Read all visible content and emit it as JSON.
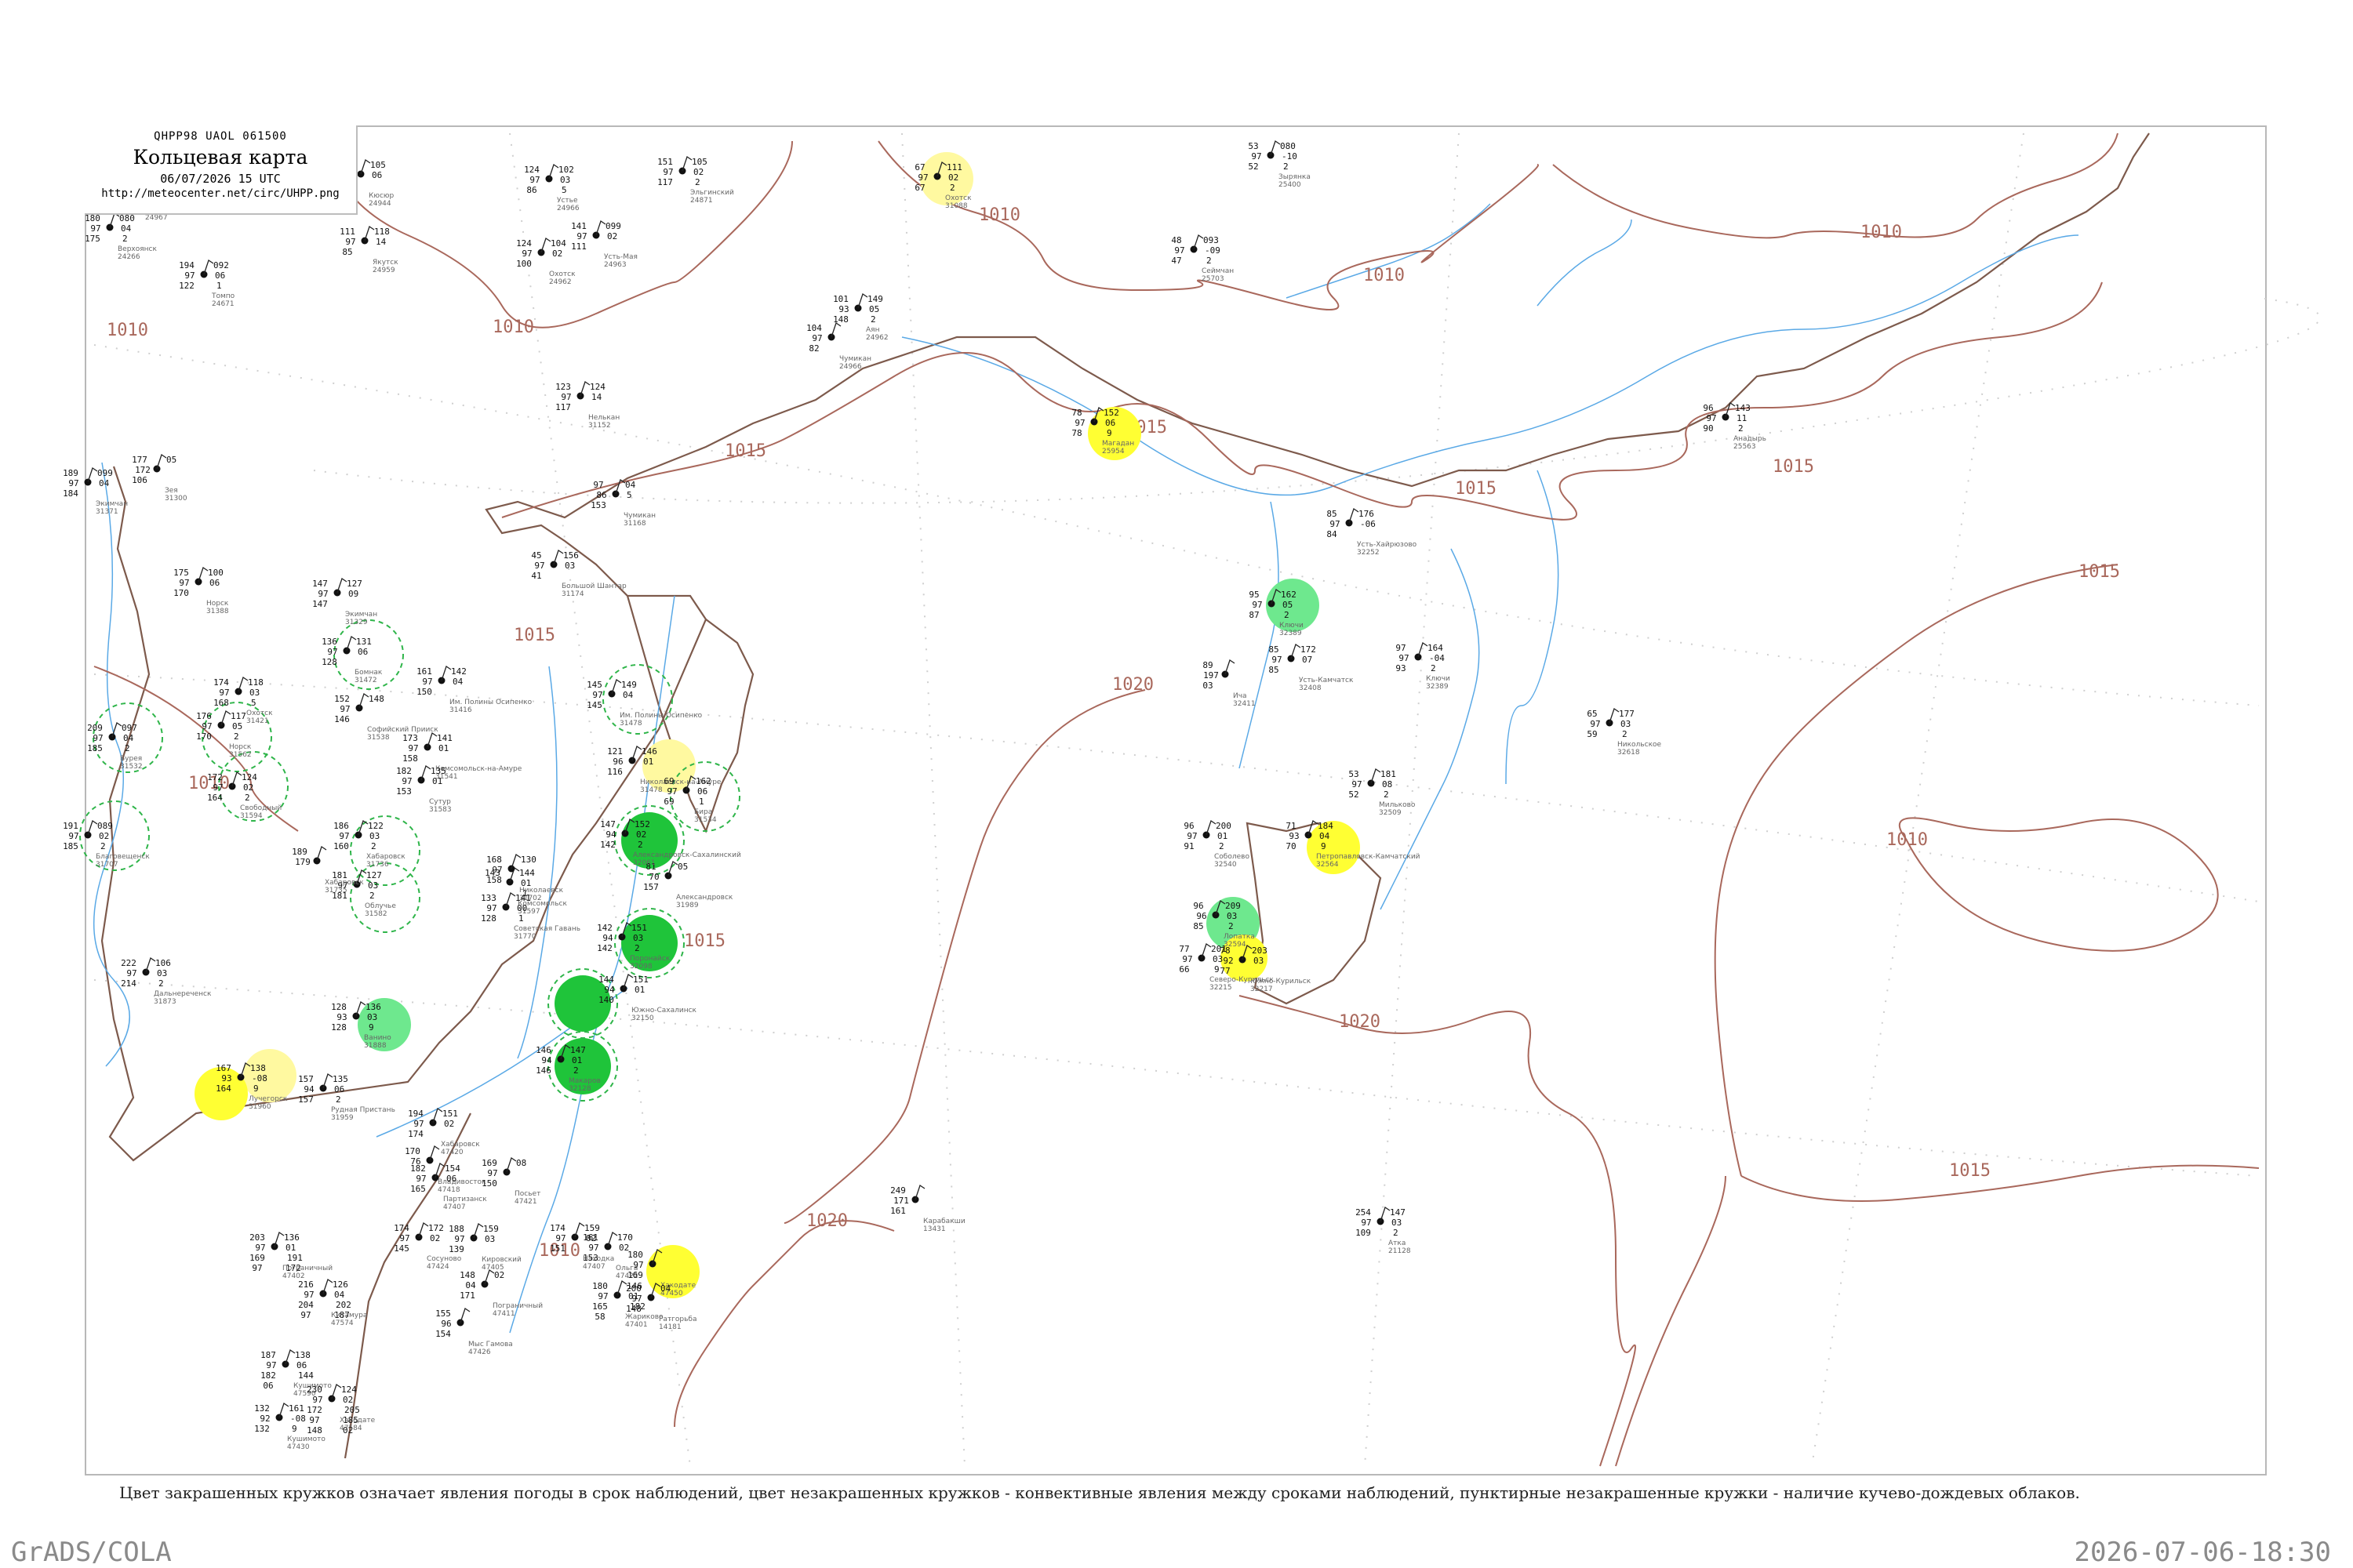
{
  "header": {
    "code_line": "QHPP98  UAOL  061500",
    "title": "Кольцевая карта",
    "datetime": "06/07/2026 15 UTC",
    "url": "http://meteocenter.net/circ/UHPP.png"
  },
  "caption": "Цвет закрашенных кружков означает явления погоды в срок наблюдений, цвет незакрашенных кружков - конвективные явления между сроками наблюдений, пунктирные незакрашенные кружки - наличие кучево-дождевых облаков.",
  "footer": {
    "left": "GrADS/COLA",
    "right": "2026-07-06-18:30"
  },
  "colors": {
    "isobar": "#a9685c",
    "water": "#5aa9e6",
    "coast": "#7d5a4c",
    "grid": "#c8c8c8",
    "yellow": "#ffff33",
    "light_yellow": "#fff9a0",
    "green": "#1fc43a",
    "light_green": "#6ee88e",
    "cb_dash": "#2fb54a"
  },
  "isobar_labels": [
    {
      "text": "1010"
    },
    {
      "text": "1010"
    },
    {
      "text": "1010"
    },
    {
      "text": "1010"
    },
    {
      "text": "1010"
    },
    {
      "text": "1010"
    },
    {
      "text": "1015"
    },
    {
      "text": "1015"
    },
    {
      "text": "1015"
    },
    {
      "text": "1015"
    },
    {
      "text": "1015"
    },
    {
      "text": "1015"
    },
    {
      "text": "1015"
    },
    {
      "text": "1020"
    },
    {
      "text": "1020"
    },
    {
      "text": "1020"
    },
    {
      "text": "1010"
    },
    {
      "text": "1015"
    },
    {
      "text": "1010"
    }
  ],
  "stations": [
    {
      "id": "24944",
      "name": "Кюсюр",
      "vals": [
        "124",
        "97",
        "98",
        "105",
        "06"
      ]
    },
    {
      "id": "24266",
      "name": "Верхоянск",
      "vals": [
        "180",
        "97",
        "175",
        "080",
        "04",
        "2"
      ]
    },
    {
      "id": "24671",
      "name": "Томпо",
      "vals": [
        "194",
        "97",
        "122",
        "092",
        "06",
        "1"
      ]
    },
    {
      "id": "24959",
      "name": "Якутск",
      "vals": [
        "111",
        "97",
        "85",
        "118",
        "14"
      ]
    },
    {
      "id": "24967",
      "name": "Батагай",
      "vals": [
        "89",
        "97",
        "49",
        "104",
        "04"
      ]
    },
    {
      "id": "24966",
      "name": "Устье",
      "vals": [
        "124",
        "97",
        "86",
        "102",
        "03",
        "5"
      ]
    },
    {
      "id": "24871",
      "name": "Эльгинский",
      "vals": [
        "151",
        "97",
        "117",
        "105",
        "02",
        "2"
      ]
    },
    {
      "id": "24963",
      "name": "Усть-Мая",
      "vals": [
        "141",
        "97",
        "111",
        "099",
        "02"
      ]
    },
    {
      "id": "24962",
      "name": "Охотск",
      "vals": [
        "124",
        "97",
        "100",
        "104",
        "02"
      ]
    },
    {
      "id": "25400",
      "name": "Зырянка",
      "vals": [
        "53",
        "97",
        "52",
        "080",
        "-10",
        "2"
      ]
    },
    {
      "id": "31088",
      "name": "Охотск",
      "vals": [
        "67",
        "97",
        "67",
        "111",
        "02",
        "2"
      ]
    },
    {
      "id": "25703",
      "name": "Сеймчан",
      "vals": [
        "48",
        "97",
        "47",
        "093",
        "-09",
        "2"
      ]
    },
    {
      "id": "24962b",
      "name": "Аян",
      "vals": [
        "101",
        "93",
        "148",
        "149",
        "05",
        "2"
      ]
    },
    {
      "id": "24966b",
      "name": "Чумикан",
      "vals": [
        "104",
        "97",
        "82"
      ]
    },
    {
      "id": "31152",
      "name": "Нелькан",
      "vals": [
        "123",
        "97",
        "117",
        "124",
        "14"
      ]
    },
    {
      "id": "31168",
      "name": "Чумикан",
      "vals": [
        "97",
        "86",
        "153",
        "04",
        "5"
      ]
    },
    {
      "id": "31371",
      "name": "Экимчан",
      "vals": [
        "189",
        "97",
        "184",
        "099",
        "04"
      ]
    },
    {
      "id": "31300",
      "name": "Зея",
      "vals": [
        "177",
        "172",
        "106",
        "05"
      ]
    },
    {
      "id": "31174",
      "name": "Большой Шантар",
      "vals": [
        "45",
        "97",
        "41",
        "156",
        "03"
      ]
    },
    {
      "id": "31388",
      "name": "Норск",
      "vals": [
        "175",
        "97",
        "170",
        "100",
        "06"
      ]
    },
    {
      "id": "31329",
      "name": "Экимчан",
      "vals": [
        "147",
        "97",
        "147",
        "127",
        "09"
      ]
    },
    {
      "id": "31472",
      "name": "Бомнак",
      "vals": [
        "136",
        "97",
        "128",
        "131",
        "06"
      ]
    },
    {
      "id": "31416",
      "name": "Им. Полины Осипенко",
      "vals": [
        "161",
        "97",
        "150",
        "142",
        "04"
      ]
    },
    {
      "id": "31478",
      "name": "Им. Полины Осипенко",
      "vals": [
        "145",
        "97",
        "145",
        "149",
        "04"
      ]
    },
    {
      "id": "31421",
      "name": "Охотск",
      "vals": [
        "174",
        "97",
        "168",
        "118",
        "03",
        "5"
      ]
    },
    {
      "id": "31538",
      "name": "Софийский Прииск",
      "vals": [
        "152",
        "97",
        "146",
        "148"
      ]
    },
    {
      "id": "31532",
      "name": "Бурея",
      "vals": [
        "209",
        "97",
        "185",
        "097",
        "04",
        "2"
      ]
    },
    {
      "id": "31562",
      "name": "Норск",
      "vals": [
        "176",
        "97",
        "170",
        "117",
        "05",
        "2"
      ]
    },
    {
      "id": "31594",
      "name": "Свободный",
      "vals": [
        "172",
        "97",
        "164",
        "124",
        "02",
        "2"
      ]
    },
    {
      "id": "31541",
      "name": "Комсомольск-на-Амуре",
      "vals": [
        "173",
        "97",
        "158",
        "141",
        "01"
      ]
    },
    {
      "id": "31583",
      "name": "Сутур",
      "vals": [
        "182",
        "97",
        "153",
        "135",
        "01"
      ]
    },
    {
      "id": "31478b",
      "name": "Николаевск-на-Амуре",
      "vals": [
        "121",
        "96",
        "116",
        "146",
        "01"
      ]
    },
    {
      "id": "31534",
      "name": "Бира",
      "vals": [
        "69",
        "97",
        "69",
        "162",
        "06",
        "1"
      ]
    },
    {
      "id": "31707",
      "name": "Благовещенск",
      "vals": [
        "191",
        "97",
        "185",
        "089",
        "02",
        "2"
      ]
    },
    {
      "id": "31736",
      "name": "Хабаровск",
      "vals": [
        "186",
        "97",
        "160",
        "122",
        "03",
        "2"
      ]
    },
    {
      "id": "31582",
      "name": "Облучье",
      "vals": [
        "181",
        "97",
        "181",
        "127",
        "03",
        "2"
      ]
    },
    {
      "id": "31735",
      "name": "Хабаровск",
      "vals": [
        "189",
        "179"
      ]
    },
    {
      "id": "31597",
      "name": "Комсомольск",
      "vals": [
        "143",
        "",
        "",
        "144",
        "01",
        "1"
      ]
    },
    {
      "id": "31702",
      "name": "Николаевск",
      "vals": [
        "168",
        "97",
        "158",
        "130"
      ]
    },
    {
      "id": "31770",
      "name": "Советская Гавань",
      "vals": [
        "133",
        "97",
        "128",
        "141",
        "00",
        "1"
      ]
    },
    {
      "id": "31989",
      "name": "Александровск",
      "vals": [
        "81",
        "70",
        "157",
        "05"
      ]
    },
    {
      "id": "31888",
      "name": "Ванино",
      "vals": [
        "128",
        "93",
        "128",
        "136",
        "03",
        "9"
      ]
    },
    {
      "id": "31873",
      "name": "Дальнереченск",
      "vals": [
        "222",
        "97",
        "214",
        "106",
        "03",
        "2"
      ]
    },
    {
      "id": "31959",
      "name": "Рудная Пристань",
      "vals": [
        "157",
        "94",
        "157",
        "135",
        "06",
        "2"
      ]
    },
    {
      "id": "31960",
      "name": "Лучегорск",
      "vals": [
        "167",
        "93",
        "164",
        "138",
        "-08",
        "9"
      ]
    },
    {
      "id": "32061",
      "name": "Александровск-Сахалинский",
      "vals": [
        "147",
        "94",
        "142",
        "152",
        "02",
        "2"
      ]
    },
    {
      "id": "32098",
      "name": "Поронайск",
      "vals": [
        "142",
        "94",
        "142",
        "151",
        "03",
        "2"
      ]
    },
    {
      "id": "32150",
      "name": "Южно-Сахалинск",
      "vals": [
        "144",
        "94",
        "140",
        "151",
        "01"
      ]
    },
    {
      "id": "32128",
      "name": "Макаров",
      "vals": [
        "146",
        "94",
        "146",
        "147",
        "01",
        "2"
      ]
    },
    {
      "id": "25954",
      "name": "Магадан",
      "vals": [
        "78",
        "97",
        "78",
        "152",
        "06",
        "9"
      ]
    },
    {
      "id": "25563",
      "name": "Анадырь",
      "vals": [
        "96",
        "97",
        "90",
        "143",
        "11",
        "2"
      ]
    },
    {
      "id": "32389",
      "name": "Ключи",
      "vals": [
        "95",
        "97",
        "87",
        "162",
        "05",
        "2"
      ]
    },
    {
      "id": "32252",
      "name": "Усть-Хайрюзово",
      "vals": [
        "85",
        "97",
        "84",
        "176",
        "-06"
      ]
    },
    {
      "id": "32411",
      "name": "Ича",
      "vals": [
        "89",
        "197",
        "03"
      ]
    },
    {
      "id": "32389b",
      "name": "Ключи",
      "vals": [
        "97",
        "97",
        "93",
        "164",
        "-04",
        "2"
      ]
    },
    {
      "id": "32408",
      "name": "Усть-Камчатск",
      "vals": [
        "85",
        "97",
        "85",
        "172",
        "07"
      ]
    },
    {
      "id": "32618",
      "name": "Никольское",
      "vals": [
        "65",
        "97",
        "59",
        "177",
        "03",
        "2"
      ]
    },
    {
      "id": "32509",
      "name": "Мильково",
      "vals": [
        "53",
        "97",
        "52",
        "181",
        "08",
        "2"
      ]
    },
    {
      "id": "32564",
      "name": "Петропавловск-Камчатский",
      "vals": [
        "71",
        "93",
        "70",
        "184",
        "04",
        "9"
      ]
    },
    {
      "id": "32540",
      "name": "Соболево",
      "vals": [
        "96",
        "97",
        "91",
        "200",
        "01",
        "2"
      ]
    },
    {
      "id": "32594",
      "name": "Лопатка",
      "vals": [
        "96",
        "96",
        "85",
        "209",
        "03",
        "2"
      ]
    },
    {
      "id": "32215",
      "name": "Северо-Курильск",
      "vals": [
        "77",
        "97",
        "66",
        "201",
        "03",
        "9"
      ]
    },
    {
      "id": "32217",
      "name": "Южно-Курильск",
      "vals": [
        "78",
        "92",
        "77",
        "203",
        "03"
      ]
    },
    {
      "id": "47420",
      "name": "Хабаровск",
      "vals": [
        "194",
        "97",
        "174",
        "151",
        "02"
      ]
    },
    {
      "id": "47418",
      "name": "Владивосток",
      "vals": [
        "170",
        "76"
      ]
    },
    {
      "id": "47407",
      "name": "Партизанск",
      "vals": [
        "182",
        "97",
        "165",
        "154",
        "06"
      ]
    },
    {
      "id": "47421",
      "name": "Посьет",
      "vals": [
        "169",
        "97",
        "150",
        "08"
      ]
    },
    {
      "id": "47405",
      "name": "Кировский",
      "vals": [
        "188",
        "97",
        "139",
        "159",
        "03"
      ]
    },
    {
      "id": "47407b",
      "name": "Находка",
      "vals": [
        "174",
        "97",
        "151",
        "159",
        "02"
      ]
    },
    {
      "id": "47422",
      "name": "Ольга",
      "vals": [
        "161",
        "97",
        "153",
        "170",
        "02"
      ]
    },
    {
      "id": "47411",
      "name": "Пограничный",
      "vals": [
        "148",
        "04",
        "171",
        "02"
      ]
    },
    {
      "id": "47424",
      "name": "Сосуново",
      "vals": [
        "174",
        "97",
        "145",
        "172",
        "02"
      ]
    },
    {
      "id": "47426",
      "name": "Мыс Гамова",
      "vals": [
        "155",
        "96",
        "154"
      ]
    },
    {
      "id": "47401",
      "name": "Жариково",
      "vals": [
        "180",
        "97",
        "165",
        "146",
        "01",
        "182",
        "58"
      ]
    },
    {
      "id": "47402",
      "name": "Пограничный",
      "vals": [
        "203",
        "97",
        "169",
        "136",
        "01",
        "191",
        "97",
        "172"
      ]
    },
    {
      "id": "47574",
      "name": "Китамура",
      "vals": [
        "216",
        "97",
        "204",
        "126",
        "04",
        "202",
        "97",
        "187"
      ]
    },
    {
      "id": "47590",
      "name": "Кушимото",
      "vals": [
        "187",
        "97",
        "182",
        "138",
        "06",
        "144",
        "06"
      ]
    },
    {
      "id": "47584",
      "name": "Хакодате",
      "vals": [
        "230",
        "97",
        "172",
        "124",
        "02",
        "205",
        "97",
        "185",
        "148",
        "02"
      ]
    },
    {
      "id": "47430",
      "name": "Кушимото",
      "vals": [
        "132",
        "92",
        "132",
        "161",
        "-08",
        "9"
      ]
    },
    {
      "id": "47450",
      "name": "Хакодате",
      "vals": [
        "180",
        "97",
        "169"
      ]
    },
    {
      "id": "14181",
      "name": "Ратгорьба",
      "vals": [
        "200",
        "97",
        "148",
        "04"
      ]
    },
    {
      "id": "13431",
      "name": "Карабакши",
      "vals": [
        "249",
        "171",
        "161"
      ]
    },
    {
      "id": "21128",
      "name": "Атка",
      "vals": [
        "254",
        "97",
        "109",
        "147",
        "03",
        "2"
      ]
    }
  ]
}
